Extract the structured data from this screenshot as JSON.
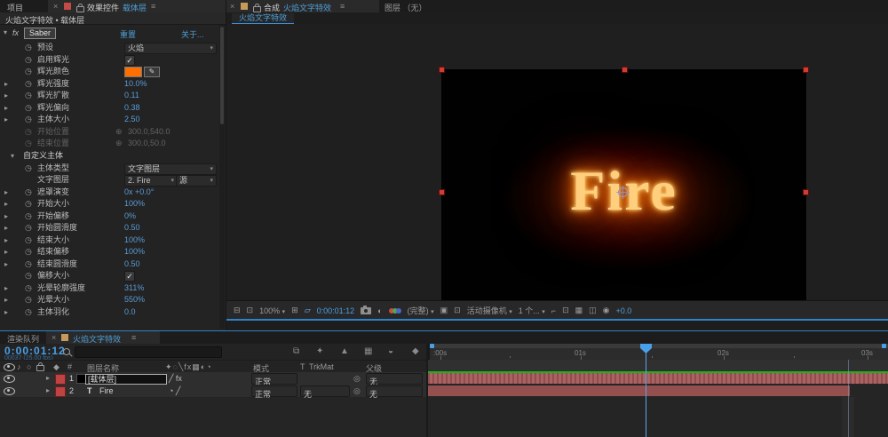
{
  "colors": {
    "accent_blue": "#4f9fd8",
    "value_blue": "#5b9bd5",
    "glow_swatch": "#ff6e00",
    "label_red": "#c04343",
    "layer_bar": "#a85a5a",
    "cache_green": "#17b417"
  },
  "icons": {
    "close": "×",
    "menu": "≡",
    "twirl_open": "▾",
    "twirl_closed": "▸",
    "stopwatch": "◷",
    "caret": "▾",
    "check": "✓",
    "crosshair": "⊕",
    "fx_badge": "fx",
    "pickwhip": "◎",
    "audio": "♪",
    "solo": "○",
    "label_header": "◆",
    "hash": "#",
    "switches_header": "✦◌╲fx▦◐◔",
    "grid": "⊞",
    "mask": "▱",
    "roi": "▣",
    "transparency": "⊡",
    "monitor": "⊟",
    "preview": "⊡",
    "flowchart": "⧉",
    "draft3d": "✦",
    "shy": "▲",
    "frame_blend": "▦",
    "motion_blur": "◒",
    "graph_editor": "◆",
    "view_opt1": "⌐",
    "view_opt2": "⊡",
    "view_opt3": "▦",
    "view_opt4": "◫",
    "exposure": "◉"
  },
  "effect_panel": {
    "tab_project": "项目",
    "tab_effect_controls": "效果控件",
    "tab_layer_name": "载体层",
    "subtitle": "火焰文字特效 • 载体层",
    "effect": {
      "twirl": "▾",
      "fx": "fx",
      "name": "Saber",
      "reset": "重置",
      "about": "关于..."
    },
    "params": {
      "preset": {
        "label": "预设",
        "value": "火焰"
      },
      "enable_glow": {
        "label": "启用辉光",
        "checked": "✓"
      },
      "glow_color": {
        "label": "辉光颜色",
        "color": "#ff6e00"
      },
      "glow_intensity": {
        "label": "辉光强度",
        "value": "10.0%"
      },
      "glow_spread": {
        "label": "辉光扩散",
        "value": "0.11"
      },
      "glow_bias": {
        "label": "辉光偏向",
        "value": "0.38"
      },
      "core_size": {
        "label": "主体大小",
        "value": "2.50"
      },
      "start_position": {
        "label": "开始位置",
        "value": "300.0,540.0"
      },
      "end_position": {
        "label": "结束位置",
        "value": "300.0,50.0"
      },
      "customize_core": {
        "label": "自定义主体"
      },
      "core_type": {
        "label": "主体类型",
        "value": "文字图层"
      },
      "text_layer": {
        "label": "文字图层",
        "value": "2. Fire",
        "source": "源"
      },
      "mask_evolution": {
        "label": "遮罩演变",
        "value": "0x +0.0°"
      },
      "start_size": {
        "label": "开始大小",
        "value": "100%"
      },
      "start_offset": {
        "label": "开始偏移",
        "value": "0%"
      },
      "start_roundness": {
        "label": "开始圆滑度",
        "value": "0.50"
      },
      "end_size": {
        "label": "结束大小",
        "value": "100%"
      },
      "end_offset": {
        "label": "结束偏移",
        "value": "100%"
      },
      "end_roundness": {
        "label": "结束圆滑度",
        "value": "0.50"
      },
      "offset_size": {
        "label": "偏移大小",
        "checked": "✓"
      },
      "halo_contour_intensity": {
        "label": "光晕轮廓强度",
        "value": "311%"
      },
      "halo_size": {
        "label": "光晕大小",
        "value": "550%"
      },
      "core_feather": {
        "label": "主体羽化",
        "value": "0.0"
      }
    }
  },
  "viewer": {
    "tab_comp_label": "合成",
    "tab_comp_name": "火焰文字特效",
    "tab_layer": "图层 （无）",
    "active_comp": "火焰文字特效",
    "canvas_text": "Fire",
    "toolbar": {
      "zoom": "100%",
      "timecode": "0:00:01:12",
      "resolution": "(完整)",
      "camera_view": "活动摄像机",
      "view_count": "1 个...",
      "exposure": "+0.0"
    }
  },
  "timeline": {
    "tab_render_queue": "渲染队列",
    "tab_comp": "火焰文字特效",
    "timecode": "0:00:01:12",
    "frame_info": "00037 (25.00 fps)",
    "headers": {
      "layer_name": "图层名称",
      "mode": "模式",
      "t": "T",
      "trkmat": "TrkMat",
      "parent": "父级"
    },
    "ruler_labels": {
      "0": ":00s",
      "1": "01s",
      "2": "02s",
      "3": "03s"
    },
    "layers": {
      "0": {
        "index": "1",
        "name": "[载体层]",
        "switches": "╱ fx",
        "mode": "正常",
        "parent": "无"
      },
      "1": {
        "index": "2",
        "badge": "T",
        "name": "Fire",
        "switches": "◔ ╱",
        "mode": "正常",
        "trkmat": "无",
        "parent": "无"
      }
    }
  }
}
